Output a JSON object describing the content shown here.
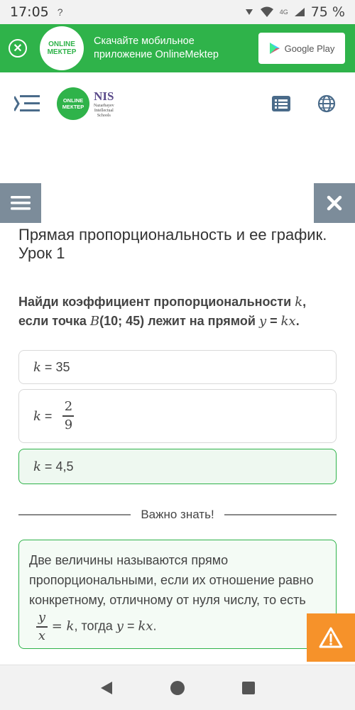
{
  "status": {
    "time": "17:05",
    "left_mark": "?",
    "network": "4G",
    "battery": "75 %"
  },
  "promo": {
    "logo_line1": "ONLINE",
    "logo_line2": "МЕКТЕР",
    "text": "Скачайте мобильное приложение OnlineMektep",
    "store_label": "Google Play"
  },
  "header": {
    "logo_line1": "ONLINE",
    "logo_line2": "МЕКТЕР",
    "nis": "NIS",
    "nis_sub1": "Nazarbayev",
    "nis_sub2": "Intellectual",
    "nis_sub3": "Schools"
  },
  "lesson": {
    "title": "Прямая пропорциональность и ее график. Урок 1"
  },
  "question": {
    "part1": "Найди коэффициент пропорциональности ",
    "k": "k",
    "part2": ", если точка ",
    "B": "B",
    "part3": "(10; 45) лежит на прямой ",
    "y": "y",
    "eq": " = ",
    "kx": "kx",
    "dot": "."
  },
  "options": [
    {
      "var": "k",
      "eq": " = ",
      "value": "35"
    },
    {
      "var": "k",
      "eq": " = ",
      "num": "2",
      "den": "9"
    },
    {
      "var": "k",
      "eq": " = ",
      "value": "4,5"
    }
  ],
  "divider": {
    "label": "Важно знать!"
  },
  "info": {
    "text": "Две величины называются прямо пропорциональными, если их отношение равно конкретному, отличному от нуля числу, то есть ",
    "num": "y",
    "den": "x",
    "eq_k": " = k",
    "mid": ", тогда ",
    "y": "y",
    "eq": " = ",
    "kx": "kx",
    "dot": "."
  },
  "colors": {
    "green": "#2fb34a",
    "orange": "#f6922a",
    "gray_button": "#7c8c9a"
  }
}
